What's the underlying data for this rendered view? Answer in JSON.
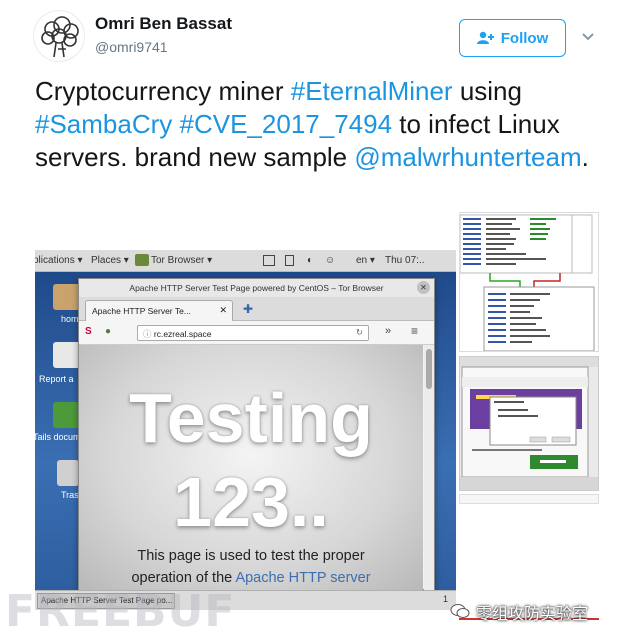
{
  "author": {
    "name": "Omri Ben Bassat",
    "handle": "@omri9741"
  },
  "follow_button": {
    "label": "Follow"
  },
  "tweet": {
    "t1": "Cryptocurrency miner ",
    "tag1": "#EternalMiner",
    "t2": " using ",
    "tag2": "#SambaCry",
    "t3": " ",
    "tag3": "#CVE_2017_7494",
    "t4": " to infect Linux servers. brand new sample ",
    "tag4": "@malwrhunterteam",
    "t5": "."
  },
  "screenshot": {
    "topbar": {
      "applications": "plications ▾",
      "places": "Places ▾",
      "browser": "Tor Browser ▾",
      "lang": "en ▾",
      "clock": "Thu 07:.."
    },
    "desktop_icons": [
      "hom",
      "Report a",
      "Tails docum",
      "Tras"
    ],
    "window": {
      "title": "Apache HTTP Server Test Page powered by CentOS – Tor Browser",
      "tab_label": "Apache HTTP Server Te...",
      "url": "rc.ezreal.space",
      "heading1": "Testing",
      "heading2": "123..",
      "body_line1": "This page is used to test the proper",
      "body_line2_pre": "operation of the ",
      "body_line2_link": "Apache HTTP server"
    },
    "taskbar_item": "Apache HTTP Server Test Page po...",
    "taskbar_page": "1"
  },
  "watermark": {
    "left": "FREEBUF",
    "right": "零组攻防实验室"
  },
  "colors": {
    "link_blue": "#1b95e0",
    "follow_blue": "#1da1f2",
    "desktop_blue": "#2b4d80"
  }
}
